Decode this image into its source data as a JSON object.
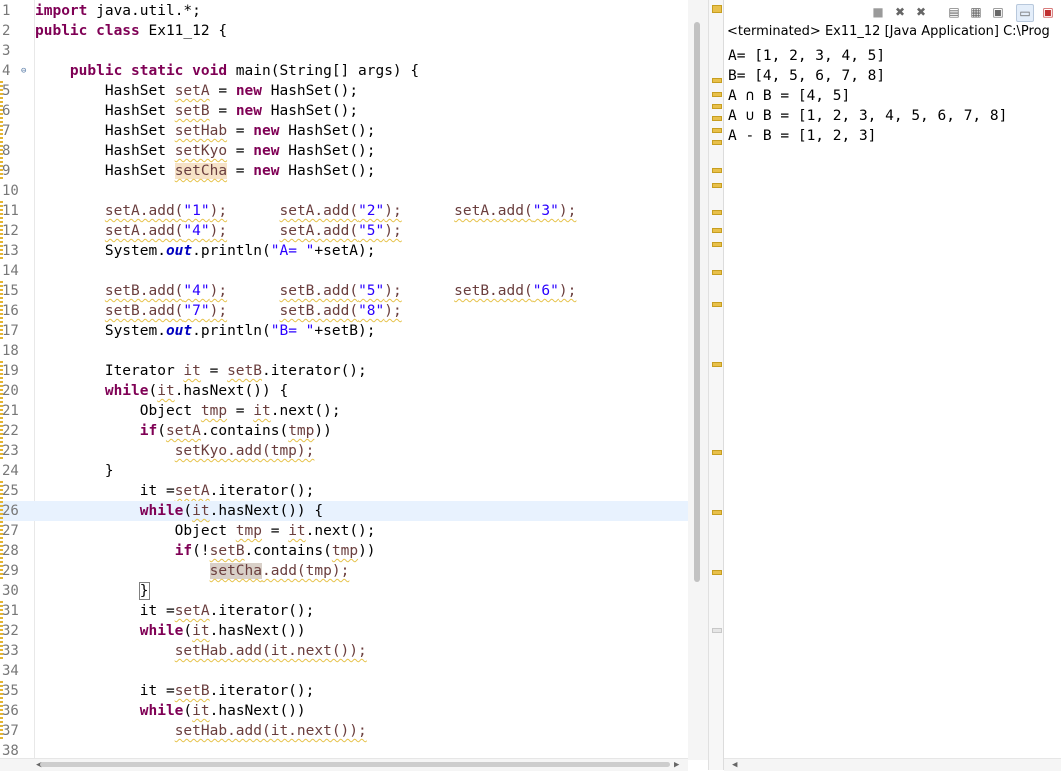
{
  "editor": {
    "lines": [
      {
        "n": "1",
        "html": "<span class=\"kw\">import</span> java.util.*;"
      },
      {
        "n": "2",
        "html": "<span class=\"kw\">public class</span> Ex11_12 {"
      },
      {
        "n": "3",
        "html": ""
      },
      {
        "n": "4",
        "fold": true,
        "html": "    <span class=\"kw\">public static void</span> main(String[] args) {"
      },
      {
        "n": "5",
        "html": "        HashSet <span class=\"var\">setA</span> = <span class=\"kw\">new</span> HashSet();"
      },
      {
        "n": "6",
        "html": "        HashSet <span class=\"var\">setB</span> = <span class=\"kw\">new</span> HashSet();"
      },
      {
        "n": "7",
        "html": "        HashSet <span class=\"var\">setHab</span> = <span class=\"kw\">new</span> HashSet();"
      },
      {
        "n": "8",
        "html": "        HashSet <span class=\"var\">setKyo</span> = <span class=\"kw\">new</span> HashSet();"
      },
      {
        "n": "9",
        "html": "        HashSet <span class=\"var hl\">setCha</span> = <span class=\"kw\">new</span> HashSet();"
      },
      {
        "n": "10",
        "html": ""
      },
      {
        "n": "11",
        "html": "        <span class=\"var\">setA.add(<span class=\"str\">\"1\"</span>);</span>      <span class=\"var\">setA.add(<span class=\"str\">\"2\"</span>);</span>      <span class=\"var\">setA.add(<span class=\"str\">\"3\"</span>);</span>"
      },
      {
        "n": "12",
        "html": "        <span class=\"var\">setA.add(<span class=\"str\">\"4\"</span>);</span>      <span class=\"var\">setA.add(<span class=\"str\">\"5\"</span>);</span>"
      },
      {
        "n": "13",
        "html": "        System.<span class=\"fld\">out</span>.println(<span class=\"str\">\"A= \"</span>+setA);"
      },
      {
        "n": "14",
        "html": ""
      },
      {
        "n": "15",
        "html": "        <span class=\"var\">setB.add(<span class=\"str\">\"4\"</span>);</span>      <span class=\"var\">setB.add(<span class=\"str\">\"5\"</span>);</span>      <span class=\"var\">setB.add(<span class=\"str\">\"6\"</span>);</span>"
      },
      {
        "n": "16",
        "html": "        <span class=\"var\">setB.add(<span class=\"str\">\"7\"</span>);</span>      <span class=\"var\">setB.add(<span class=\"str\">\"8\"</span>);</span>"
      },
      {
        "n": "17",
        "html": "        System.<span class=\"fld\">out</span>.println(<span class=\"str\">\"B= \"</span>+setB);"
      },
      {
        "n": "18",
        "html": ""
      },
      {
        "n": "19",
        "html": "        Iterator <span class=\"var\">it</span> = <span class=\"var\">setB</span>.iterator();"
      },
      {
        "n": "20",
        "html": "        <span class=\"kw\">while</span>(<span class=\"var\">it</span>.hasNext()) {"
      },
      {
        "n": "21",
        "html": "            Object <span class=\"var\">tmp</span> = <span class=\"var\">it</span>.next();"
      },
      {
        "n": "22",
        "html": "            <span class=\"kw\">if</span>(<span class=\"var\">setA</span>.contains(<span class=\"var\">tmp</span>))"
      },
      {
        "n": "23",
        "html": "                <span class=\"var\">setKyo.add(tmp);</span>"
      },
      {
        "n": "24",
        "html": "        }"
      },
      {
        "n": "25",
        "html": "            it =<span class=\"var\">setA</span>.iterator();"
      },
      {
        "n": "26",
        "current": true,
        "html": "            <span class=\"kw\">while</span>(<span class=\"var\">it</span>.hasNext()) {"
      },
      {
        "n": "27",
        "html": "                Object <span class=\"var\">tmp</span> = <span class=\"var\">it</span>.next();"
      },
      {
        "n": "28",
        "html": "                <span class=\"kw\">if</span>(!<span class=\"var\">setB</span>.contains(<span class=\"var\">tmp</span>))"
      },
      {
        "n": "29",
        "html": "                    <span class=\"var\"><span class=\"hl2\">setCha</span>.add(tmp);</span>"
      },
      {
        "n": "30",
        "html": "            <span class=\"brk\">}</span>"
      },
      {
        "n": "31",
        "html": "            it =<span class=\"var\">setA</span>.iterator();"
      },
      {
        "n": "32",
        "html": "            <span class=\"kw\">while</span>(<span class=\"var\">it</span>.hasNext())"
      },
      {
        "n": "33",
        "html": "                <span class=\"var\">setHab.add(it.next());</span>"
      },
      {
        "n": "34",
        "html": ""
      },
      {
        "n": "35",
        "html": "            it =<span class=\"var\">setB</span>.iterator();"
      },
      {
        "n": "36",
        "html": "            <span class=\"kw\">while</span>(<span class=\"var\">it</span>.hasNext())"
      },
      {
        "n": "37",
        "html": "                <span class=\"var\">setHab.add(it.next());</span>"
      },
      {
        "n": "38",
        "html": ""
      }
    ]
  },
  "console": {
    "header": "<terminated> Ex11_12 [Java Application] C:\\Prog",
    "output": [
      "A= [1, 2, 3, 4, 5]",
      "B= [4, 5, 6, 7, 8]",
      "A ∩ B = [4, 5]",
      "A ∪ B = [1, 2, 3, 4, 5, 6, 7, 8]",
      "A - B = [1, 2, 3]"
    ]
  },
  "colors": {
    "keyword": "#7f0055",
    "string": "#2a00ff",
    "static_field": "#0000c0",
    "current_line": "#e8f2fe",
    "warning": "#e8c04a"
  },
  "icons": [
    "terminate-icon",
    "remove-launch-icon",
    "remove-all-icon",
    "scroll-lock-icon",
    "word-wrap-icon",
    "show-console-icon",
    "pin-console-icon",
    "open-console-icon"
  ]
}
